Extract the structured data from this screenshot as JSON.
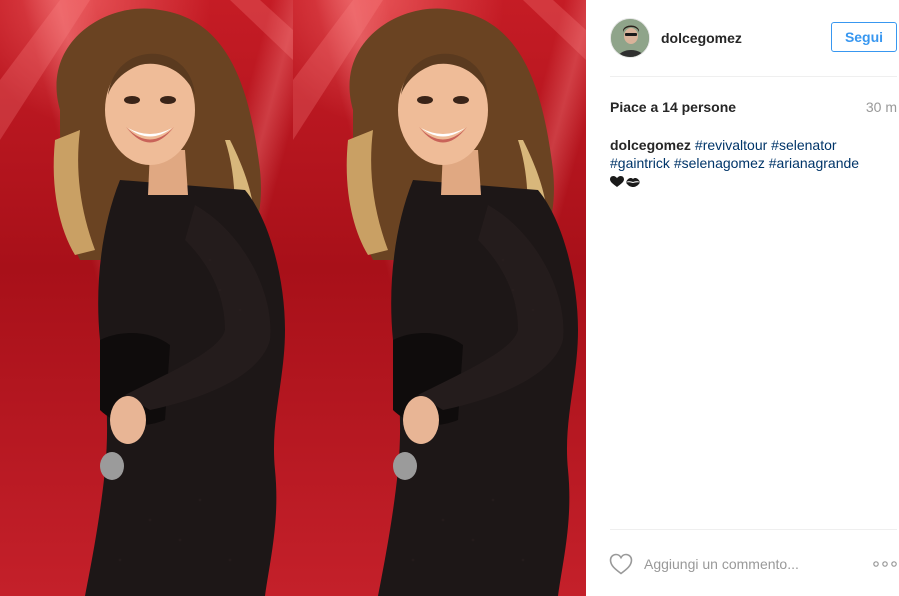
{
  "post": {
    "photo_alt": "Foto",
    "author": {
      "username": "dolcegomez",
      "follow_label": "Segui"
    },
    "likes_label": "Piace a 14 persone",
    "time_label": "30 m",
    "caption": {
      "author": "dolcegomez",
      "hashtags": [
        "#revivaltour",
        "#selenator",
        "#gaintrick",
        "#selenagomez",
        "#arianagrande"
      ],
      "emojis": [
        "black-heart-icon",
        "kiss-mark-icon"
      ]
    },
    "comment_placeholder": "Aggiungi un commento...",
    "colors": {
      "link_blue": "#003569",
      "button_blue": "#3897f0",
      "muted_gray": "#999999",
      "photo_background": "#b8151f"
    }
  }
}
